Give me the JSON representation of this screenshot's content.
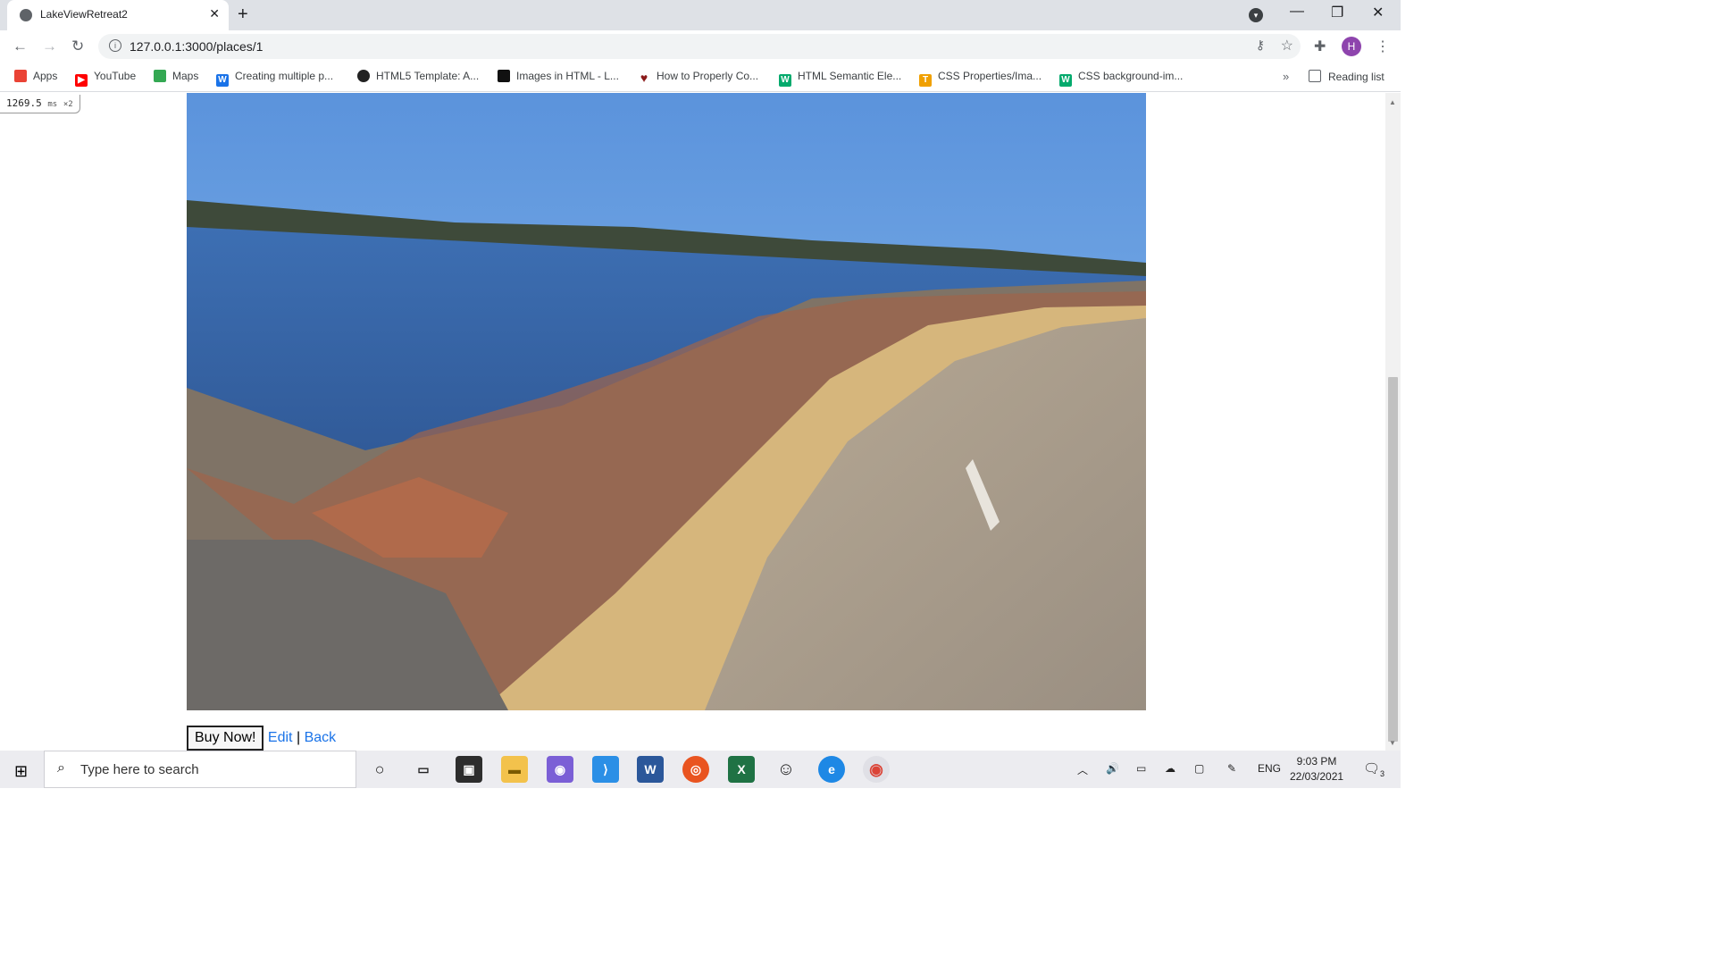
{
  "browser": {
    "tab_title": "LakeViewRetreat2",
    "url": "127.0.0.1:3000/places/1",
    "profile_initial": "H"
  },
  "bookmarks": [
    {
      "label": "Apps",
      "icon": "apps-grid-icon",
      "color": "#ea4335"
    },
    {
      "label": "YouTube",
      "icon": "youtube-icon",
      "color": "#ff0000"
    },
    {
      "label": "Maps",
      "icon": "maps-icon",
      "color": "#34a853"
    },
    {
      "label": "Creating multiple p...",
      "icon": "w3schools-icon",
      "color": "#1a73e8"
    },
    {
      "label": "HTML5 Template: A...",
      "icon": "sitepoint-icon",
      "color": "#222222"
    },
    {
      "label": "Images in HTML - L...",
      "icon": "codecademy-icon",
      "color": "#111111"
    },
    {
      "label": "How to Properly Co...",
      "icon": "heart-icon",
      "color": "#8b1a1a"
    },
    {
      "label": "HTML Semantic Ele...",
      "icon": "w3schools-green-icon",
      "color": "#04aa6d"
    },
    {
      "label": "CSS Properties/Ima...",
      "icon": "tutorial-icon",
      "color": "#f0a000"
    },
    {
      "label": "CSS background-im...",
      "icon": "w3schools-green-icon",
      "color": "#04aa6d"
    }
  ],
  "reading_list": "Reading list",
  "perf": {
    "value": "1269.5",
    "unit": "ms",
    "scale": "×2"
  },
  "actions": {
    "buy": "Buy Now!",
    "edit": "Edit",
    "separator": "|",
    "back": "Back"
  },
  "taskbar": {
    "search_placeholder": "Type here to search",
    "language": "ENG",
    "time": "9:03 PM",
    "date": "22/03/2021",
    "notifications": "3"
  }
}
